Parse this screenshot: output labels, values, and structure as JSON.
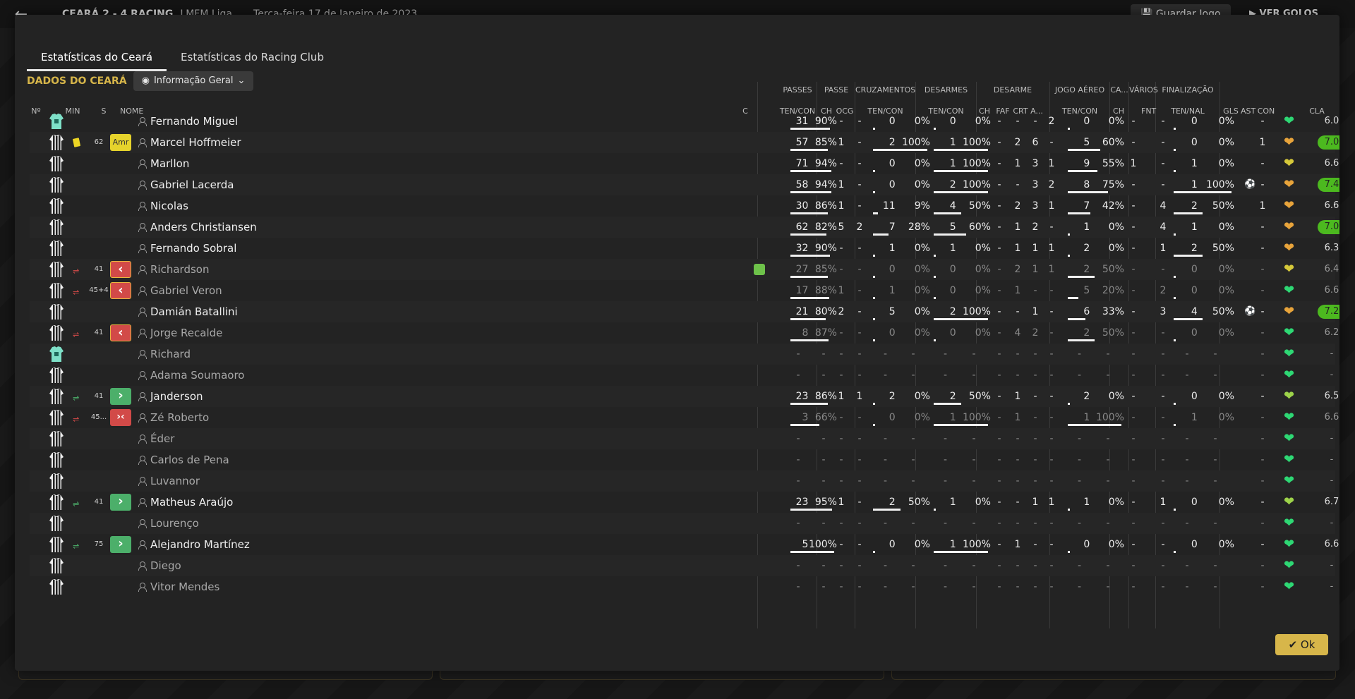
{
  "topbar": {
    "match": "CEARÁ   2 - 4   RACING",
    "league": "LMFM Liga",
    "date": "Terça-feira 17 de Janeiro de 2023",
    "save_label": "Guardar Jogo",
    "goals_label": "VER GOLOS"
  },
  "tabs": [
    "Estatísticas do Ceará",
    "Estatísticas do Racing Club"
  ],
  "team_label": "DADOS DO CEARÁ",
  "view_dropdown": "Informação Geral",
  "groups": {
    "passes": "PASSES",
    "passe": "PASSE",
    "cruz": "CRUZAMENTOS",
    "desarmes": "DESARMES",
    "desarme": "DESARME",
    "aereo": "JOGO AÉREO",
    "ca": "CA...",
    "varios": "VÁRIOS",
    "final": "FINALIZAÇÃO"
  },
  "cols": {
    "no": "Nº",
    "min": "MIN",
    "s": "S",
    "nome": "NOME",
    "c": "C",
    "tc1": "TEN/CON",
    "ch1": "CH",
    "ocg": "OCG",
    "tc2": "TEN/CON",
    "tc3": "TEN/CON",
    "ch2": "CH",
    "faf": "FAF",
    "crt": "CRT",
    "a": "A...",
    "tc4": "TEN/CON",
    "ch3": "CH",
    "fnt": "FNT",
    "tn": "TEN/NAL",
    "gls": "GLS",
    "ast": "AST",
    "con": "CON",
    "cla": "CLA"
  },
  "players": [
    {
      "name": "Fernando Miguel",
      "gk": true,
      "p": [
        "31",
        "90%"
      ],
      "ch": "-",
      "ocg": "-",
      "cr": [
        "0",
        "0%"
      ],
      "de": [
        "0",
        "0%"
      ],
      "ch2": "-",
      "faf": "-",
      "crt": "-",
      "a": "2",
      "ae": [
        "0",
        "0%"
      ],
      "ch3": "-",
      "fnt": "-",
      "fi": [
        "0",
        "0%"
      ],
      "gls": "",
      "ast": "-",
      "con": "green",
      "cla": "6.0"
    },
    {
      "name": "Marcel Hoffmeier",
      "yc": true,
      "min": "62",
      "badge": "Amr",
      "p": [
        "57",
        "85%"
      ],
      "ch": "1",
      "ocg": "-",
      "cr": [
        "2",
        "100%"
      ],
      "de": [
        "1",
        "100%"
      ],
      "ch2": "-",
      "faf": "2",
      "crt": "6",
      "a": "-",
      "ae": [
        "5",
        "60%"
      ],
      "ch3": "-",
      "fnt": "-",
      "fi": [
        "0",
        "0%"
      ],
      "gls": "",
      "ast": "1",
      "con": "orange",
      "cla": "7.0",
      "hi": true
    },
    {
      "name": "Marllon",
      "p": [
        "71",
        "94%"
      ],
      "ch": "-",
      "ocg": "-",
      "cr": [
        "0",
        "0%"
      ],
      "de": [
        "1",
        "100%"
      ],
      "ch2": "-",
      "faf": "1",
      "crt": "3",
      "a": "1",
      "ae": [
        "9",
        "55%"
      ],
      "ch3": "1",
      "fnt": "-",
      "fi": [
        "1",
        "0%"
      ],
      "gls": "",
      "ast": "-",
      "con": "yellow",
      "cla": "6.6"
    },
    {
      "name": "Gabriel Lacerda",
      "p": [
        "58",
        "94%"
      ],
      "ch": "1",
      "ocg": "-",
      "cr": [
        "0",
        "0%"
      ],
      "de": [
        "2",
        "100%"
      ],
      "ch2": "-",
      "faf": "-",
      "crt": "3",
      "a": "2",
      "ae": [
        "8",
        "75%"
      ],
      "ch3": "-",
      "fnt": "-",
      "fi": [
        "1",
        "100%"
      ],
      "gls": "ball",
      "ast": "-",
      "con": "orange",
      "cla": "7.4",
      "hi": true
    },
    {
      "name": "Nicolas",
      "p": [
        "30",
        "86%"
      ],
      "ch": "1",
      "ocg": "-",
      "cr": [
        "11",
        "9%"
      ],
      "de": [
        "4",
        "50%"
      ],
      "ch2": "-",
      "faf": "2",
      "crt": "3",
      "a": "1",
      "ae": [
        "7",
        "42%"
      ],
      "ch3": "-",
      "fnt": "4",
      "fi": [
        "2",
        "50%"
      ],
      "gls": "",
      "ast": "1",
      "con": "orange",
      "cla": "6.6"
    },
    {
      "name": "Anders Christiansen",
      "p": [
        "62",
        "82%"
      ],
      "ch": "5",
      "ocg": "2",
      "cr": [
        "7",
        "28%"
      ],
      "de": [
        "5",
        "60%"
      ],
      "ch2": "-",
      "faf": "1",
      "crt": "2",
      "a": "-",
      "ae": [
        "1",
        "0%"
      ],
      "ch3": "-",
      "fnt": "4",
      "fi": [
        "1",
        "0%"
      ],
      "gls": "",
      "ast": "-",
      "con": "orange",
      "cla": "7.0",
      "hi": true
    },
    {
      "name": "Fernando Sobral",
      "p": [
        "32",
        "90%"
      ],
      "ch": "-",
      "ocg": "-",
      "cr": [
        "1",
        "0%"
      ],
      "de": [
        "1",
        "0%"
      ],
      "ch2": "-",
      "faf": "1",
      "crt": "1",
      "a": "1",
      "ae": [
        "2",
        "0%"
      ],
      "ch3": "-",
      "fnt": "1",
      "fi": [
        "2",
        "50%"
      ],
      "gls": "",
      "ast": "-",
      "con": "orange",
      "cla": "6.3"
    },
    {
      "name": "Richardson",
      "dim": true,
      "arr": "off",
      "min": "41",
      "badge": "off",
      "boot": true,
      "p": [
        "27",
        "85%"
      ],
      "ch": "-",
      "ocg": "-",
      "cr": [
        "0",
        "0%"
      ],
      "de": [
        "0",
        "0%"
      ],
      "ch2": "-",
      "faf": "2",
      "crt": "1",
      "a": "1",
      "ae": [
        "2",
        "50%"
      ],
      "ch3": "-",
      "fnt": "-",
      "fi": [
        "0",
        "0%"
      ],
      "gls": "",
      "ast": "-",
      "con": "yellow",
      "cla": "6.4"
    },
    {
      "name": "Gabriel Veron",
      "dim": true,
      "arr": "off",
      "min": "45+4",
      "badge": "off",
      "p": [
        "17",
        "88%"
      ],
      "ch": "1",
      "ocg": "-",
      "cr": [
        "1",
        "0%"
      ],
      "de": [
        "0",
        "0%"
      ],
      "ch2": "-",
      "faf": "1",
      "crt": "-",
      "a": "-",
      "ae": [
        "5",
        "20%"
      ],
      "ch3": "-",
      "fnt": "2",
      "fi": [
        "0",
        "0%"
      ],
      "gls": "",
      "ast": "-",
      "con": "green",
      "cla": "6.6"
    },
    {
      "name": "Damián Batallini",
      "p": [
        "21",
        "80%"
      ],
      "ch": "2",
      "ocg": "-",
      "cr": [
        "5",
        "0%"
      ],
      "de": [
        "2",
        "100%"
      ],
      "ch2": "-",
      "faf": "-",
      "crt": "1",
      "a": "-",
      "ae": [
        "6",
        "33%"
      ],
      "ch3": "-",
      "fnt": "3",
      "fi": [
        "4",
        "50%"
      ],
      "gls": "ball",
      "ast": "-",
      "con": "orange",
      "cla": "7.2",
      "hi": true
    },
    {
      "name": "Jorge Recalde",
      "dim": true,
      "arr": "off",
      "min": "41",
      "badge": "off",
      "p": [
        "8",
        "87%"
      ],
      "ch": "-",
      "ocg": "-",
      "cr": [
        "0",
        "0%"
      ],
      "de": [
        "0",
        "0%"
      ],
      "ch2": "-",
      "faf": "4",
      "crt": "2",
      "a": "-",
      "ae": [
        "2",
        "50%"
      ],
      "ch3": "-",
      "fnt": "-",
      "fi": [
        "0",
        "0%"
      ],
      "gls": "",
      "ast": "-",
      "con": "green",
      "cla": "6.2"
    },
    {
      "name": "Richard",
      "dim": true,
      "gk": true,
      "empty": true,
      "con": "green",
      "cla": "-"
    },
    {
      "name": "Adama Soumaoro",
      "dim": true,
      "empty": true,
      "con": "green",
      "cla": "-"
    },
    {
      "name": "Janderson",
      "arr": "on",
      "min": "41",
      "badge": "on",
      "p": [
        "23",
        "86%"
      ],
      "ch": "1",
      "ocg": "1",
      "cr": [
        "2",
        "0%"
      ],
      "de": [
        "2",
        "50%"
      ],
      "ch2": "-",
      "faf": "1",
      "crt": "-",
      "a": "-",
      "ae": [
        "2",
        "0%"
      ],
      "ch3": "-",
      "fnt": "-",
      "fi": [
        "0",
        "0%"
      ],
      "gls": "",
      "ast": "-",
      "con": "yellowgreen",
      "cla": "6.5"
    },
    {
      "name": "Zé Roberto",
      "dim": true,
      "arr": "both",
      "min": "45...",
      "badge": "both",
      "p": [
        "3",
        "66%"
      ],
      "ch": "-",
      "ocg": "-",
      "cr": [
        "0",
        "0%"
      ],
      "de": [
        "1",
        "100%"
      ],
      "ch2": "-",
      "faf": "1",
      "crt": "-",
      "a": "-",
      "ae": [
        "1",
        "100%"
      ],
      "ch3": "-",
      "fnt": "-",
      "fi": [
        "1",
        "0%"
      ],
      "gls": "",
      "ast": "-",
      "con": "green",
      "cla": "6.6"
    },
    {
      "name": "Éder",
      "dim": true,
      "empty": true,
      "con": "green",
      "cla": "-"
    },
    {
      "name": "Carlos de Pena",
      "dim": true,
      "empty": true,
      "con": "green",
      "cla": "-"
    },
    {
      "name": "Luvannor",
      "dim": true,
      "empty": true,
      "con": "green",
      "cla": "-"
    },
    {
      "name": "Matheus Araújo",
      "arr": "on",
      "min": "41",
      "badge": "on",
      "p": [
        "23",
        "95%"
      ],
      "ch": "1",
      "ocg": "-",
      "cr": [
        "2",
        "50%"
      ],
      "de": [
        "1",
        "0%"
      ],
      "ch2": "-",
      "faf": "-",
      "crt": "1",
      "a": "1",
      "ae": [
        "1",
        "0%"
      ],
      "ch3": "-",
      "fnt": "1",
      "fi": [
        "0",
        "0%"
      ],
      "gls": "",
      "ast": "-",
      "con": "yellowgreen",
      "cla": "6.7"
    },
    {
      "name": "Lourenço",
      "dim": true,
      "empty": true,
      "con": "green",
      "cla": "-"
    },
    {
      "name": "Alejandro Martínez",
      "arr": "on",
      "min": "75",
      "badge": "on",
      "p": [
        "5",
        "100%"
      ],
      "ch": "-",
      "ocg": "-",
      "cr": [
        "0",
        "0%"
      ],
      "de": [
        "1",
        "100%"
      ],
      "ch2": "-",
      "faf": "1",
      "crt": "-",
      "a": "-",
      "ae": [
        "0",
        "0%"
      ],
      "ch3": "-",
      "fnt": "-",
      "fi": [
        "0",
        "0%"
      ],
      "gls": "",
      "ast": "-",
      "con": "green",
      "cla": "6.6"
    },
    {
      "name": "Diego",
      "dim": true,
      "empty": true,
      "con": "green",
      "cla": "-"
    },
    {
      "name": "Vitor Mendes",
      "dim": true,
      "empty": true,
      "con": "green",
      "cla": "-"
    }
  ],
  "ok_label": "Ok",
  "colors": {
    "accent": "#d7b64a",
    "hi": "#4cb91f"
  }
}
